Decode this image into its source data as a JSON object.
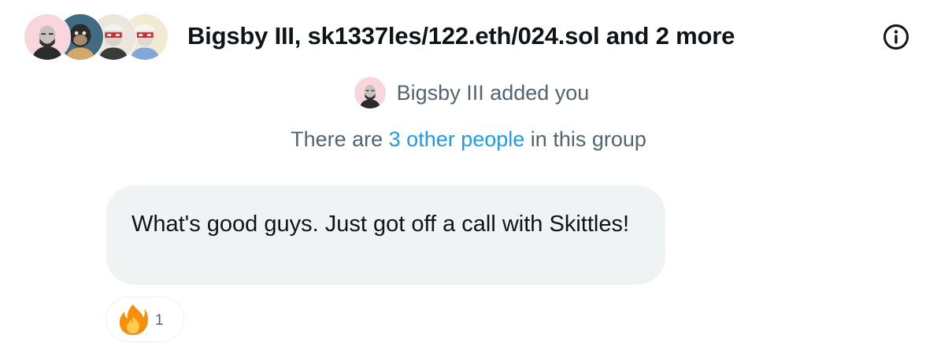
{
  "header": {
    "title": "Bigsby III, sk1337les/122.eth/024.sol and 2 more",
    "avatars": [
      {
        "name": "bigsby-avatar-icon"
      },
      {
        "name": "ape-avatar-icon"
      },
      {
        "name": "laser-eyes-avatar-icon"
      },
      {
        "name": "laser-eyes-avatar-icon"
      }
    ],
    "info_icon": "info-icon"
  },
  "conversation": {
    "system_message": "Bigsby III added you",
    "group_info": {
      "prefix": "There are ",
      "link": "3 other people",
      "suffix": " in this group"
    },
    "message": {
      "text": "What's good guys. Just got off a call with Skittles!",
      "reaction": {
        "emoji_icon": "fire-emoji-icon",
        "count": "1"
      }
    }
  },
  "colors": {
    "accent": "#1d9bf0",
    "secondary_text": "#536471",
    "bubble_bg": "#eff3f4"
  }
}
